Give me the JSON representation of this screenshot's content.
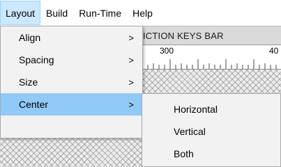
{
  "menubar": {
    "items": [
      "Layout",
      "Build",
      "Run-Time",
      "Help"
    ]
  },
  "background_window": {
    "title": "ICTION KEYS BAR",
    "ruler_labels": [
      "300",
      "40"
    ]
  },
  "layout_menu": {
    "items": [
      {
        "label": "Align",
        "arrow": ">"
      },
      {
        "label": "Spacing",
        "arrow": ">"
      },
      {
        "label": "Size",
        "arrow": ">"
      },
      {
        "label": "Center",
        "arrow": ">"
      }
    ]
  },
  "center_submenu": {
    "items": [
      "Horizontal",
      "Vertical",
      "Both"
    ]
  },
  "colors": {
    "menubar_active": "#cce8ff",
    "menu_highlight": "#91c9f7",
    "menu_background": "#f2f2f2"
  }
}
